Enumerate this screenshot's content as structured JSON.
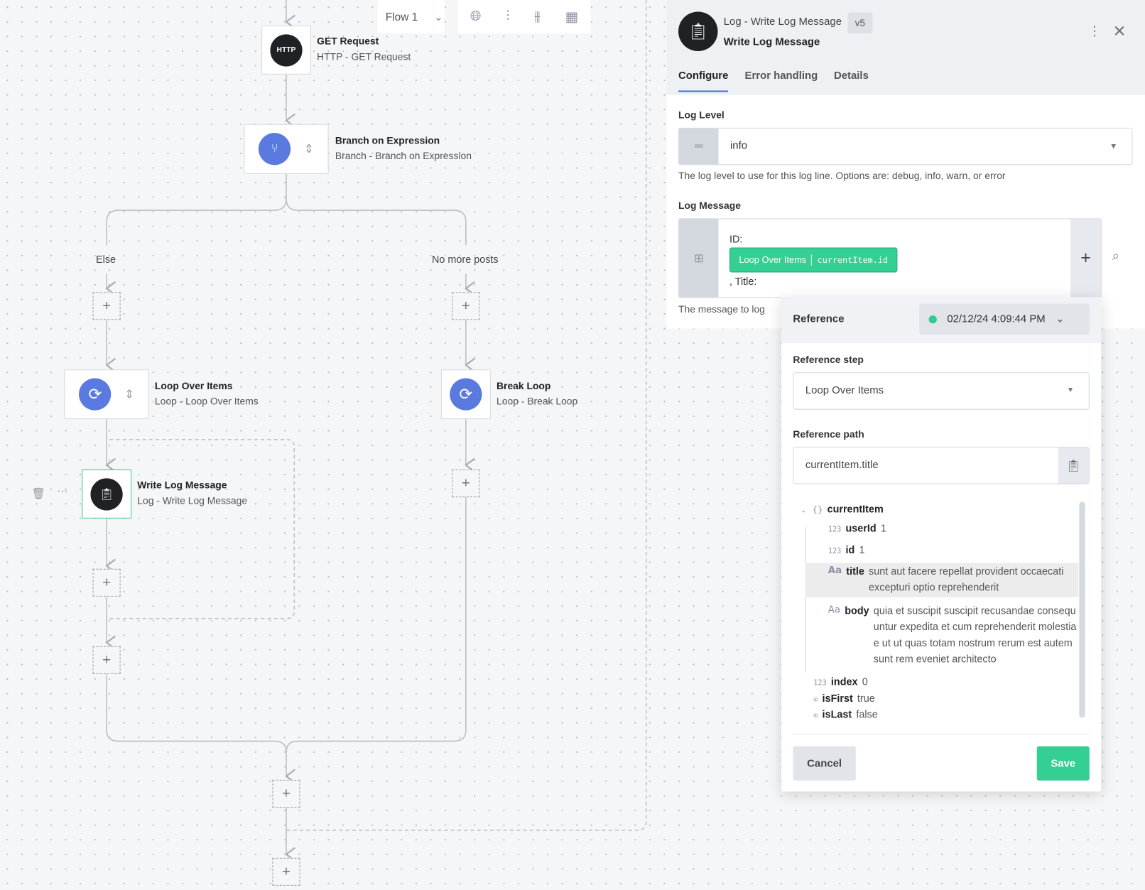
{
  "toolbar": {
    "flow_select": "Flow 1",
    "icons": [
      "globe-icon",
      "sliders-icon",
      "sliders-settings-icon",
      "grid-icon"
    ]
  },
  "nodes": {
    "get": {
      "icon": "HTTP",
      "title": "GET Request",
      "subtitle": "HTTP - GET Request"
    },
    "branch": {
      "title": "Branch on Expression",
      "subtitle": "Branch - Branch on Expression"
    },
    "loop": {
      "title": "Loop Over Items",
      "subtitle": "Loop - Loop Over Items"
    },
    "break": {
      "title": "Break Loop",
      "subtitle": "Loop - Break Loop"
    },
    "write": {
      "title": "Write Log Message",
      "subtitle": "Log - Write Log Message"
    }
  },
  "branches": {
    "else": "Else",
    "no_more": "No more posts"
  },
  "panel": {
    "subtitle": "Log - Write Log Message",
    "version": "v5",
    "title": "Write Log Message",
    "tabs": [
      "Configure",
      "Error handling",
      "Details"
    ],
    "log_level": {
      "label": "Log Level",
      "value": "info",
      "help": "The log level to use for this log line. Options are: debug, info, warn, or error"
    },
    "log_message": {
      "label": "Log Message",
      "prefix": "ID:",
      "chip_step": "Loop Over Items",
      "chip_path": "currentItem.id",
      "suffix": ", Title:",
      "help": "The message to log"
    }
  },
  "reference": {
    "title": "Reference",
    "timestamp": "02/12/24 4:09:44 PM",
    "status_color": "#34c98e",
    "step_label": "Reference step",
    "step_value": "Loop Over Items",
    "path_label": "Reference path",
    "path_value": "currentItem.title",
    "tree": {
      "root": "currentItem",
      "children": [
        {
          "type": "123",
          "key": "userId",
          "value": "1"
        },
        {
          "type": "Aa",
          "key": "id",
          "value": "1"
        },
        {
          "type": "Aa",
          "key": "title",
          "value": "sunt aut facere repellat provident occaecati excepturi optio reprehenderit"
        },
        {
          "type": "Aa",
          "key": "body",
          "value": "quia et suscipit suscipit recusandae consequuntur expedita et cum reprehenderit molestiae ut ut quas totam nostrum rerum est autem sunt rem eveniet architecto"
        }
      ],
      "siblings": [
        {
          "type": "123",
          "key": "index",
          "value": "0"
        },
        {
          "type": "toggle",
          "key": "isFirst",
          "value": "true"
        },
        {
          "type": "toggle",
          "key": "isLast",
          "value": "false"
        }
      ]
    },
    "cancel": "Cancel",
    "save": "Save"
  },
  "colors": {
    "accent": "#34c98e",
    "blue": "#5a7ae0",
    "tab_underline": "#4a6fd6"
  }
}
